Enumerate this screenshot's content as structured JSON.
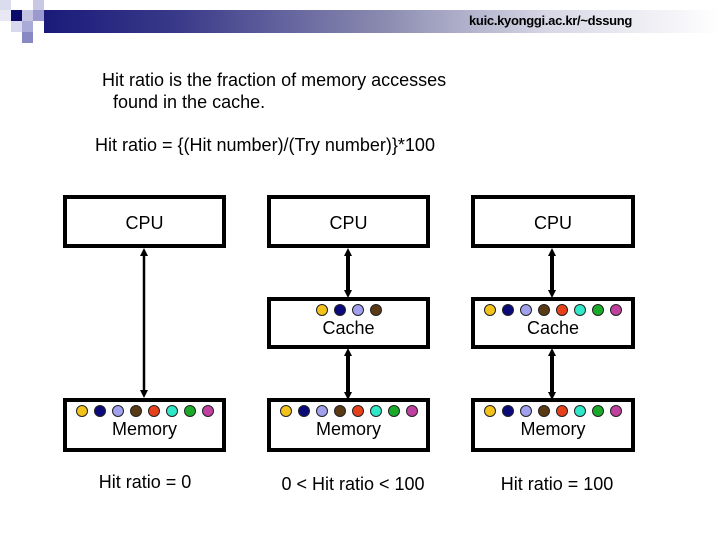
{
  "header": {
    "url": "kuic.kyonggi.ac.kr/~dssung",
    "accent_colors": [
      "#1a1a7a",
      "#9999cc",
      "#ccccee"
    ]
  },
  "intro": {
    "line1": "Hit ratio is the fraction of memory accesses",
    "line2": "found in the cache.",
    "formula": "Hit ratio = {(Hit number)/(Try number)}*100"
  },
  "dot_colors": [
    "#f2c21b",
    "#0a0a7a",
    "#a0a0ee",
    "#5a3a14",
    "#e8401a",
    "#2ee8c8",
    "#1aaa2a",
    "#c040a0"
  ],
  "columns": [
    {
      "cpu_label": "CPU",
      "has_cache": false,
      "cache_label": "",
      "cache_dot_count": 0,
      "memory_label": "Memory",
      "memory_dot_count": 8,
      "caption": "Hit ratio = 0"
    },
    {
      "cpu_label": "CPU",
      "has_cache": true,
      "cache_label": "Cache",
      "cache_dot_count": 4,
      "memory_label": "Memory",
      "memory_dot_count": 8,
      "caption": "0 < Hit ratio < 100"
    },
    {
      "cpu_label": "CPU",
      "has_cache": true,
      "cache_label": "Cache",
      "cache_dot_count": 8,
      "memory_label": "Memory",
      "memory_dot_count": 8,
      "caption": "Hit ratio = 100"
    }
  ]
}
